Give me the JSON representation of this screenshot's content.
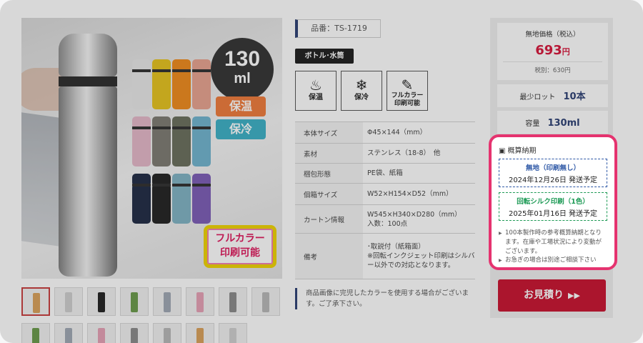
{
  "product": {
    "code_label": "品番：TS-1719",
    "category": "ボトル･水筒",
    "features": [
      {
        "icon": "flame-icon",
        "glyph": "♨",
        "label": "保温"
      },
      {
        "icon": "snowflake-icon",
        "glyph": "❄",
        "label": "保冷"
      },
      {
        "icon": "print-icon",
        "glyph": "✎",
        "label": "フルカラー\n印刷可能"
      }
    ]
  },
  "image": {
    "capacity_number": "130",
    "capacity_unit": "ml",
    "tag_warm": "保温",
    "tag_cool": "保冷",
    "fullcolor_line1": "フルカラー",
    "fullcolor_line2": "印刷可能",
    "bottle_colors": [
      "#e8e8e8",
      "#e6c21d",
      "#f08a1b",
      "#e8a38f",
      "#e5b8c8",
      "#7d7b72",
      "#6a6e5c",
      "#6fb4cf",
      "#1f2a44",
      "#222222",
      "#7fb3c4",
      "#7c5cb6"
    ]
  },
  "specs": [
    {
      "key": "本体サイズ",
      "value": "Φ45×144（mm）"
    },
    {
      "key": "素材",
      "value": "ステンレス（18-8）　他"
    },
    {
      "key": "梱包形態",
      "value": "PE袋、紙箱"
    },
    {
      "key": "個箱サイズ",
      "value": "W52×H154×D52（mm）"
    },
    {
      "key": "カートン情報",
      "value": "W545×H340×D280（mm）\n入数：100点"
    },
    {
      "key": "備考",
      "value": "･取説付（紙箱面）\n※回転インクジェット印刷はシルバー以外での対応となります。"
    }
  ],
  "notice": "商品画像に完児したカラーを使用する場合がございます。ご了承下さい。",
  "pricing": {
    "label": "無地価格（税込）",
    "price": "693",
    "yen": "円",
    "tax_excluded": "税別：630円"
  },
  "min_lot": {
    "label": "最少ロット",
    "value": "10本"
  },
  "capacity": {
    "label": "容量",
    "value": "130ml"
  },
  "delivery": {
    "title": "概算納期",
    "plain": {
      "label": "無地（印刷無し）",
      "date": "2024年12月26日 発送予定"
    },
    "silk": {
      "label": "回転シルク印刷（1色）",
      "date": "2025年01月16日 発送予定"
    },
    "note1": "100本製作時の参考概算納期となります。在庫や工場状況により変動がございます。",
    "note2": "お急ぎの場合は別途ご相談下さい"
  },
  "quote_button": {
    "label": "お見積り",
    "arrow": "▶▶"
  },
  "thumbnails": {
    "row1_count": 8,
    "row2_count": 7,
    "colors": [
      "#d9a05a",
      "#cfcfcf",
      "#222",
      "#6a9a4a",
      "#9fa8b4",
      "#e6a0b5",
      "#8a8a8a",
      "#b8b8b8"
    ]
  },
  "colors": {
    "accent_red": "#c8122f",
    "price_red": "#d7153a",
    "navy": "#2b3f73",
    "highlight_pink": "#e5336f",
    "plain_blue": "#2e58a6",
    "silk_green": "#1d9a55"
  }
}
